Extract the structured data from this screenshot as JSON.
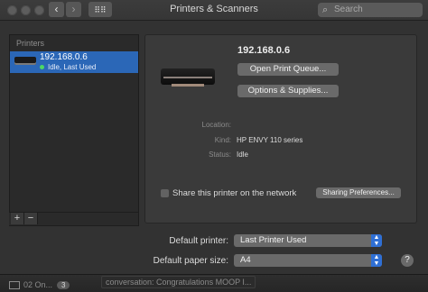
{
  "window": {
    "title": "Printers & Scanners"
  },
  "toolbar": {
    "back_icon": "chevron-left-icon",
    "forward_icon": "chevron-right-icon",
    "grid_icon": "grid-icon"
  },
  "search": {
    "placeholder": "Search",
    "icon": "search-icon"
  },
  "sidebar": {
    "header": "Printers",
    "items": [
      {
        "name": "192.168.0.6",
        "status": "Idle, Last Used",
        "status_color": "#4cd964"
      }
    ],
    "add_label": "+",
    "remove_label": "−"
  },
  "detail": {
    "printer_name": "192.168.0.6",
    "open_queue_label": "Open Print Queue...",
    "options_label": "Options & Supplies...",
    "location_label": "Location:",
    "location_value": "",
    "kind_label": "Kind:",
    "kind_value": "HP ENVY 110 series",
    "status_label": "Status:",
    "status_value": "Idle",
    "share_label": "Share this printer on the network",
    "share_checked": false,
    "sharing_prefs_label": "Sharing Preferences..."
  },
  "defaults": {
    "printer_label": "Default printer:",
    "printer_value": "Last Printer Used",
    "paper_label": "Default paper size:",
    "paper_value": "A4",
    "help_label": "?"
  },
  "dock": {
    "item1_label": "02 On...",
    "item1_badge": "3",
    "item2_label": "conversation: Congratulations MOOP I..."
  },
  "colors": {
    "accent": "#2b67b7",
    "select_arrow": "#2f6fd4"
  }
}
